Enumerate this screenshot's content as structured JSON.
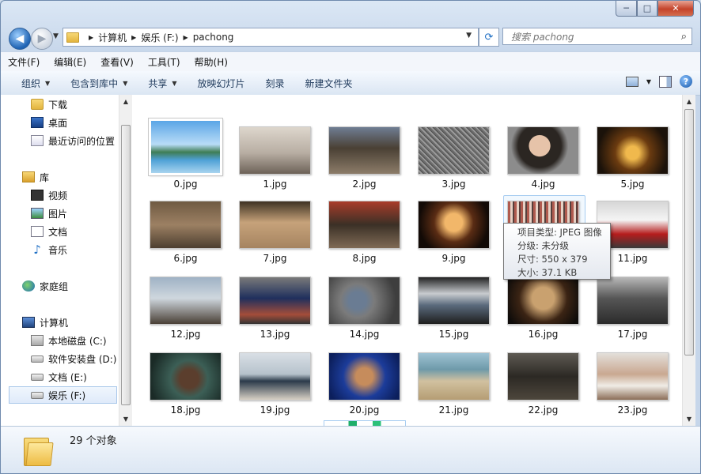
{
  "window": {
    "buttons": {
      "minimize": "─",
      "maximize": "□",
      "close": "✕"
    }
  },
  "nav": {
    "back_icon": "◀",
    "forward_icon": "▶",
    "breadcrumb": [
      "计算机",
      "娱乐 (F:)",
      "pachong"
    ],
    "refresh_icon": "⟳",
    "search_placeholder": "搜索 pachong",
    "search_icon": "⌕"
  },
  "menu": [
    "文件(F)",
    "编辑(E)",
    "查看(V)",
    "工具(T)",
    "帮助(H)"
  ],
  "commands": {
    "organize": "组织",
    "include_library": "包含到库中",
    "share": "共享",
    "slideshow": "放映幻灯片",
    "burn": "刻录",
    "new_folder": "新建文件夹",
    "help": "?"
  },
  "sidebar": {
    "favorites": [
      {
        "label": "下载"
      },
      {
        "label": "桌面"
      },
      {
        "label": "最近访问的位置"
      }
    ],
    "libraries_header": "库",
    "libraries": [
      {
        "label": "视频"
      },
      {
        "label": "图片"
      },
      {
        "label": "文档"
      },
      {
        "label": "音乐"
      }
    ],
    "homegroup": "家庭组",
    "computer_header": "计算机",
    "drives": [
      {
        "label": "本地磁盘 (C:)"
      },
      {
        "label": "软件安装盘 (D:)"
      },
      {
        "label": "文档 (E:)"
      },
      {
        "label": "娱乐 (F:)"
      }
    ]
  },
  "files": [
    {
      "name": "0.jpg",
      "bg": "linear-gradient(#5aa5e6 0%, #b9dcf7 45%, #3f7d55 60%, #4ea1d6 75%, #a8d4ef 100%)"
    },
    {
      "name": "1.jpg",
      "bg": "linear-gradient(#ddd6cc, #b8aea3 55%, #6d6258 100%)"
    },
    {
      "name": "2.jpg",
      "bg": "linear-gradient(#6f7d93, #4a4034 45%, #8c7c69 100%)"
    },
    {
      "name": "3.jpg",
      "bg": "repeating-linear-gradient(45deg,#6d6d6d 0 2px,#9a9a9a 2px 4px,#4e4e4e 4px 5px)"
    },
    {
      "name": "4.jpg",
      "bg": "radial-gradient(circle at 45% 40%, #e6c3a9 0 22%, #2b2622 23% 45%, #8c8c8c 60%)"
    },
    {
      "name": "5.jpg",
      "bg": "radial-gradient(circle at 50% 55%, #f0b94d 0 15%, #6b3b10 40%, #1b120a 80%)"
    },
    {
      "name": "6.jpg",
      "bg": "linear-gradient(#6f5a42, #9c8063 50%, #4d3f30 100%)"
    },
    {
      "name": "7.jpg",
      "bg": "linear-gradient(#3e3223, #c6a27a 45%, #a68460 100%)"
    },
    {
      "name": "8.jpg",
      "bg": "linear-gradient(#a93c2a, #3b3026 50%, #7f6a55 100%)"
    },
    {
      "name": "9.jpg",
      "bg": "radial-gradient(circle at 50% 45%, #f2b76a 0 20%, #5a2c14 45%, #120a06 80%)"
    },
    {
      "name": "10.jpg",
      "bg": "repeating-linear-gradient(90deg,#b05a4e 0 3px,#e6d1c4 3px 6px,#56403c 6px 8px)"
    },
    {
      "name": "11.jpg",
      "bg": "linear-gradient(#d6d6d6, #f4f4f4 40%, #b51d1d 70%, #3a3a3a 100%)"
    },
    {
      "name": "12.jpg",
      "bg": "linear-gradient(#9fb2c5, #cfd7de 45%, #4a4036 100%)"
    },
    {
      "name": "13.jpg",
      "bg": "linear-gradient(#7a7a7a, #1f2f5d 45%, #a44d3a 80%, #333 100%)"
    },
    {
      "name": "14.jpg",
      "bg": "radial-gradient(circle at 40% 50%, #6a7c93 0 18%, #7b7b7b 35%, #3e3e3e 80%)"
    },
    {
      "name": "15.jpg",
      "bg": "linear-gradient(#222, #c8cbcf 35%, #5a6a7c 60%, #1e1e1e 100%)"
    },
    {
      "name": "16.jpg",
      "bg": "radial-gradient(circle at 50% 45%, #c9a16f 0 25%, #3b2414 55%, #0f0c0a 90%)"
    },
    {
      "name": "17.jpg",
      "bg": "linear-gradient(#b8b8b8, #565656 45%, #2b2b2b 100%)"
    },
    {
      "name": "18.jpg",
      "bg": "radial-gradient(circle at 55% 55%, #5b3e2d 0 20%, #3c5f56 40%, #1a2a26 85%)"
    },
    {
      "name": "19.jpg",
      "bg": "linear-gradient(#d9dfe5, #b6c2cc 45%, #2b3a4a 60%, #d7d0c4 100%)"
    },
    {
      "name": "20.jpg",
      "bg": "radial-gradient(circle at 50% 50%, #c68c5c 0 20%, #1c3c9a 50%, #0c1f5c 90%)"
    },
    {
      "name": "21.jpg",
      "bg": "linear-gradient(#9fc3d4, #6e9aa9 35%, #d1c1a0 60%, #b59d73 100%)"
    },
    {
      "name": "22.jpg",
      "bg": "linear-gradient(#5e5a53, #2c2924 50%, #4d463c 100%)"
    },
    {
      "name": "23.jpg",
      "bg": "linear-gradient(#e3dfda, #c9a891 45%, #f0ece6 70%, #8c6e58 100%)"
    }
  ],
  "tooltip": {
    "type": "项目类型: JPEG 图像",
    "rating": "分级: 未分级",
    "dimensions": "尺寸: 550 x 379",
    "size": "大小: 37.1 KB"
  },
  "status": {
    "count": "29 个对象"
  }
}
